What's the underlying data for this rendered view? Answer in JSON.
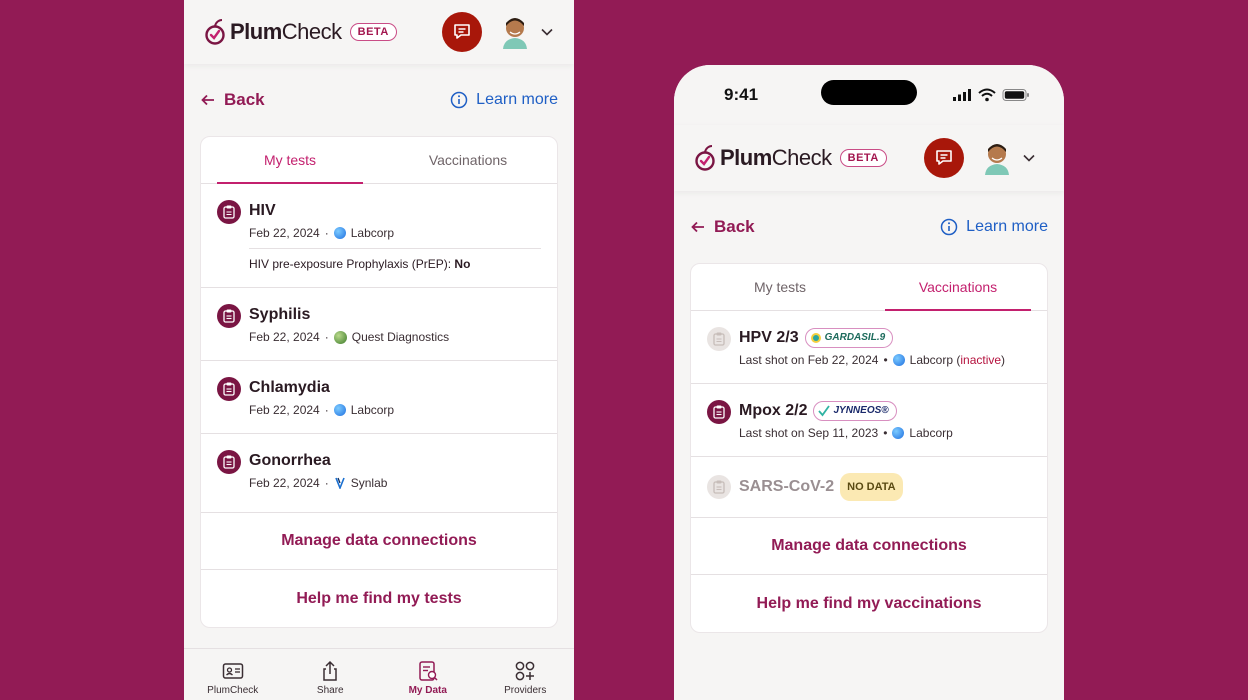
{
  "brand": {
    "name_bold": "Plum",
    "name_regular": "Check",
    "badge": "BETA"
  },
  "nav": {
    "back": "Back",
    "learn_more": "Learn more"
  },
  "left": {
    "tabs": [
      "My tests",
      "Vaccinations"
    ],
    "tests": [
      {
        "title": "HIV",
        "date": "Feb 22, 2024",
        "lab": "Labcorp",
        "extra_label": "HIV pre-exposure Prophylaxis (PrEP):",
        "extra_value": "No"
      },
      {
        "title": "Syphilis",
        "date": "Feb 22, 2024",
        "lab": "Quest Diagnostics"
      },
      {
        "title": "Chlamydia",
        "date": "Feb 22, 2024",
        "lab": "Labcorp"
      },
      {
        "title": "Gonorrhea",
        "date": "Feb 22, 2024",
        "lab": "Synlab"
      }
    ],
    "actions": [
      "Manage data connections",
      "Help me find my tests"
    ],
    "bottom_nav": [
      "PlumCheck",
      "Share",
      "My Data",
      "Providers"
    ]
  },
  "right": {
    "status_time": "9:41",
    "tabs": [
      "My tests",
      "Vaccinations"
    ],
    "vaccines": [
      {
        "title": "HPV 2/3",
        "brand": "GARDASIL.9",
        "meta_prefix": "Last shot on Feb 22, 2024",
        "lab": "Labcorp",
        "lab_note_open": "(",
        "lab_note": "inactive",
        "lab_note_close": ")"
      },
      {
        "title": "Mpox 2/2",
        "brand": "JYNNEOS®",
        "meta_prefix": "Last shot on Sep 11, 2023",
        "lab": "Labcorp"
      },
      {
        "title": "SARS-CoV-2",
        "badge": "NO DATA"
      }
    ],
    "actions": [
      "Manage data connections",
      "Help me find my vaccinations"
    ]
  },
  "colors": {
    "background": "#921b55",
    "accent": "#c3206e",
    "plum": "#921b55",
    "link": "#1f5fc5",
    "chat": "#a8170a"
  },
  "icons": [
    "plum-logo-icon",
    "chat-icon",
    "avatar",
    "chevron-down-icon",
    "arrow-left-icon",
    "info-icon",
    "clipboard-icon",
    "id-card-icon",
    "share-icon",
    "data-icon",
    "grid-plus-icon"
  ]
}
